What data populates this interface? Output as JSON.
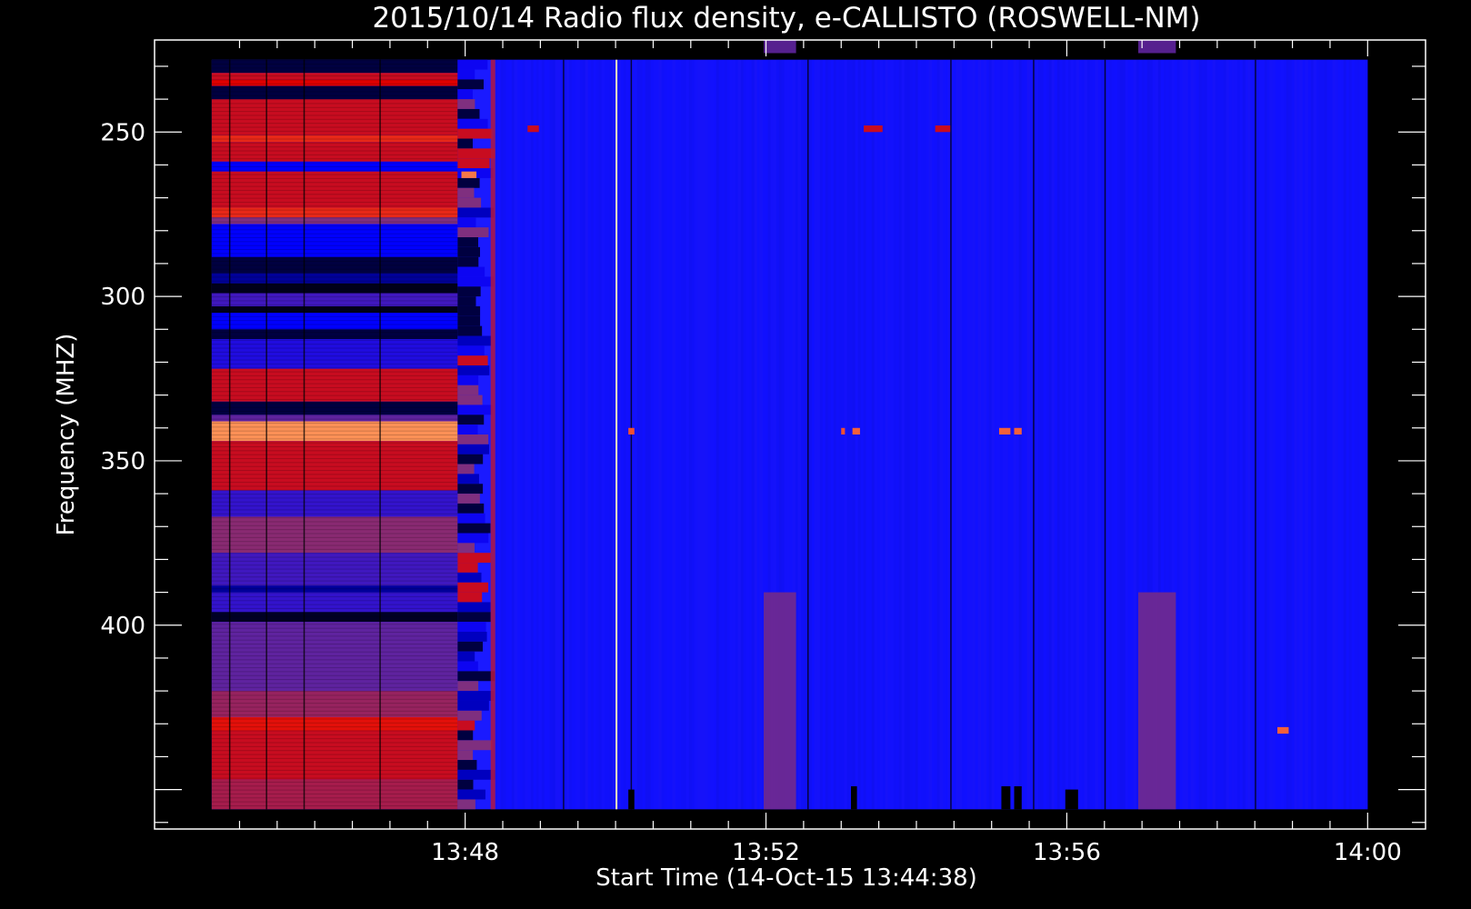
{
  "chart_data": {
    "type": "heatmap",
    "title": "2015/10/14  Radio flux density, e-CALLISTO (ROSWELL-NM)",
    "xlabel": "Start Time (14-Oct-15 13:44:38)",
    "ylabel": "Frequency (MHZ)",
    "x_ticks": [
      "13:48",
      "13:52",
      "13:56",
      "14:00"
    ],
    "x_tick_minutes": [
      228,
      232,
      236,
      240
    ],
    "x_start_minutes": 824.63,
    "x_end_minutes": 840,
    "xlim_minutes": [
      823.87,
      840.77
    ],
    "y_ticks": [
      "250",
      "300",
      "350",
      "400"
    ],
    "y_tick_values": [
      250,
      300,
      350,
      400
    ],
    "ylim": [
      222,
      462
    ],
    "data_ylim": [
      228,
      456
    ],
    "y_inverted": true,
    "colormap": [
      "#000000",
      "#0000ff",
      "#7f2f7f",
      "#e00000",
      "#ffa060",
      "#ffffff"
    ],
    "background_color": "#1a1aff",
    "quiet_level": 0.2,
    "active_period": {
      "start_minutes": 824.63,
      "end_minutes": 827.9,
      "band_levels": [
        {
          "f": [
            228,
            232
          ],
          "level": 0.05
        },
        {
          "f": [
            232,
            234
          ],
          "level": 0.55
        },
        {
          "f": [
            234,
            236
          ],
          "level": 0.6
        },
        {
          "f": [
            236,
            240
          ],
          "level": 0.05
        },
        {
          "f": [
            240,
            251
          ],
          "level": 0.55
        },
        {
          "f": [
            251,
            253
          ],
          "level": 0.65
        },
        {
          "f": [
            253,
            259
          ],
          "level": 0.55
        },
        {
          "f": [
            259,
            262
          ],
          "level": 0.2
        },
        {
          "f": [
            262,
            273
          ],
          "level": 0.55
        },
        {
          "f": [
            273,
            276
          ],
          "level": 0.65
        },
        {
          "f": [
            276,
            278
          ],
          "level": 0.4
        },
        {
          "f": [
            278,
            288
          ],
          "level": 0.2
        },
        {
          "f": [
            288,
            293
          ],
          "level": 0.05
        },
        {
          "f": [
            293,
            296
          ],
          "level": 0.12
        },
        {
          "f": [
            296,
            299
          ],
          "level": 0.02
        },
        {
          "f": [
            299,
            303
          ],
          "level": 0.3
        },
        {
          "f": [
            303,
            305
          ],
          "level": 0.02
        },
        {
          "f": [
            305,
            310
          ],
          "level": 0.2
        },
        {
          "f": [
            310,
            313
          ],
          "level": 0.05
        },
        {
          "f": [
            313,
            322
          ],
          "level": 0.25
        },
        {
          "f": [
            322,
            332
          ],
          "level": 0.55
        },
        {
          "f": [
            332,
            336
          ],
          "level": 0.05
        },
        {
          "f": [
            336,
            338
          ],
          "level": 0.35
        },
        {
          "f": [
            338,
            344
          ],
          "level": 0.78
        },
        {
          "f": [
            344,
            359
          ],
          "level": 0.55
        },
        {
          "f": [
            359,
            367
          ],
          "level": 0.28
        },
        {
          "f": [
            367,
            378
          ],
          "level": 0.42
        },
        {
          "f": [
            378,
            388
          ],
          "level": 0.3
        },
        {
          "f": [
            388,
            390
          ],
          "level": 0.12
        },
        {
          "f": [
            390,
            396
          ],
          "level": 0.28
        },
        {
          "f": [
            396,
            399
          ],
          "level": 0.03
        },
        {
          "f": [
            399,
            420
          ],
          "level": 0.35
        },
        {
          "f": [
            420,
            428
          ],
          "level": 0.45
        },
        {
          "f": [
            428,
            432
          ],
          "level": 0.62
        },
        {
          "f": [
            432,
            447
          ],
          "level": 0.55
        },
        {
          "f": [
            447,
            456
          ],
          "level": 0.48
        }
      ]
    },
    "transition": {
      "start_minutes": 827.9,
      "end_minutes": 828.4
    },
    "dark_columns_minutes": [
      824.86,
      825.35,
      825.85,
      826.86,
      829.3,
      830.2,
      832.55,
      834.45,
      835.55,
      836.5,
      838.5
    ],
    "bright_line_minutes": 830.0,
    "enhanced_regions": [
      {
        "x": [
          831.97,
          832.4
        ],
        "f": [
          390,
          456
        ],
        "level": 0.38
      },
      {
        "x": [
          836.95,
          837.45
        ],
        "f": [
          390,
          456
        ],
        "level": 0.38
      },
      {
        "x": [
          831.97,
          832.4
        ],
        "f": [
          222,
          226
        ],
        "level": 0.35
      },
      {
        "x": [
          836.95,
          837.45
        ],
        "f": [
          222,
          226
        ],
        "level": 0.35
      }
    ],
    "bursts": [
      {
        "x": [
          830.17,
          830.25
        ],
        "f": [
          340,
          342
        ],
        "level": 0.7
      },
      {
        "x": [
          833.0,
          833.05
        ],
        "f": [
          340,
          342
        ],
        "level": 0.7
      },
      {
        "x": [
          833.15,
          833.25
        ],
        "f": [
          340,
          342
        ],
        "level": 0.72
      },
      {
        "x": [
          835.1,
          835.25
        ],
        "f": [
          340,
          342
        ],
        "level": 0.72
      },
      {
        "x": [
          835.3,
          835.4
        ],
        "f": [
          340,
          342
        ],
        "level": 0.72
      },
      {
        "x": [
          828.83,
          828.98
        ],
        "f": [
          248,
          250
        ],
        "level": 0.55
      },
      {
        "x": [
          833.3,
          833.55
        ],
        "f": [
          248,
          250
        ],
        "level": 0.55
      },
      {
        "x": [
          834.25,
          834.45
        ],
        "f": [
          248,
          250
        ],
        "level": 0.55
      },
      {
        "x": [
          838.8,
          838.95
        ],
        "f": [
          431,
          433
        ],
        "level": 0.72
      },
      {
        "x": [
          827.95,
          828.15
        ],
        "f": [
          262,
          264
        ],
        "level": 0.75
      }
    ],
    "dark_spots": [
      {
        "x": [
          830.17,
          830.25
        ],
        "f": [
          450,
          456
        ],
        "level": 0.0
      },
      {
        "x": [
          833.13,
          833.21
        ],
        "f": [
          449,
          456
        ],
        "level": 0.0
      },
      {
        "x": [
          835.13,
          835.25
        ],
        "f": [
          449,
          456
        ],
        "level": 0.0
      },
      {
        "x": [
          835.3,
          835.4
        ],
        "f": [
          449,
          456
        ],
        "level": 0.0
      },
      {
        "x": [
          835.98,
          836.15
        ],
        "f": [
          450,
          456
        ],
        "level": 0.0
      }
    ],
    "grid": false
  }
}
